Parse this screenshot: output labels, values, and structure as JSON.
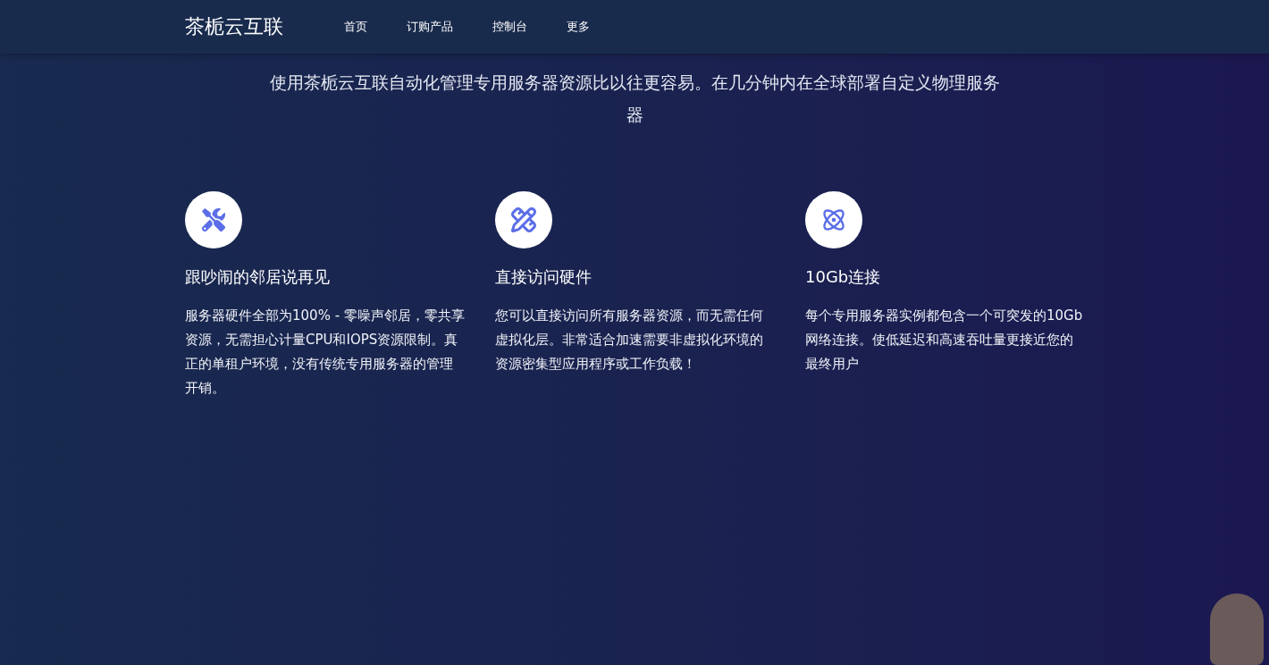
{
  "header": {
    "brand": "茶栀云互联",
    "nav": [
      {
        "label": "首页"
      },
      {
        "label": "订购产品"
      },
      {
        "label": "控制台"
      },
      {
        "label": "更多"
      }
    ]
  },
  "hero": {
    "text": "使用茶栀云互联自动化管理专用服务器资源比以往更容易。在几分钟内在全球部署自定义物理服务器"
  },
  "features": [
    {
      "title": "跟吵闹的邻居说再见",
      "text": "服务器硬件全部为100% - 零噪声邻居，零共享资源，无需担心计量CPU和IOPS资源限制。真正的单租户环境，没有传统专用服务器的管理开销。"
    },
    {
      "title": "直接访问硬件",
      "text": "您可以直接访问所有服务器资源，而无需任何虚拟化层。非常适合加速需要非虚拟化环境的资源密集型应用程序或工作负载！"
    },
    {
      "title": "10Gb连接",
      "text": "每个专用服务器实例都包含一个可突发的10Gb网络连接。使低延迟和高速吞吐量更接近您的最终用户"
    }
  ]
}
